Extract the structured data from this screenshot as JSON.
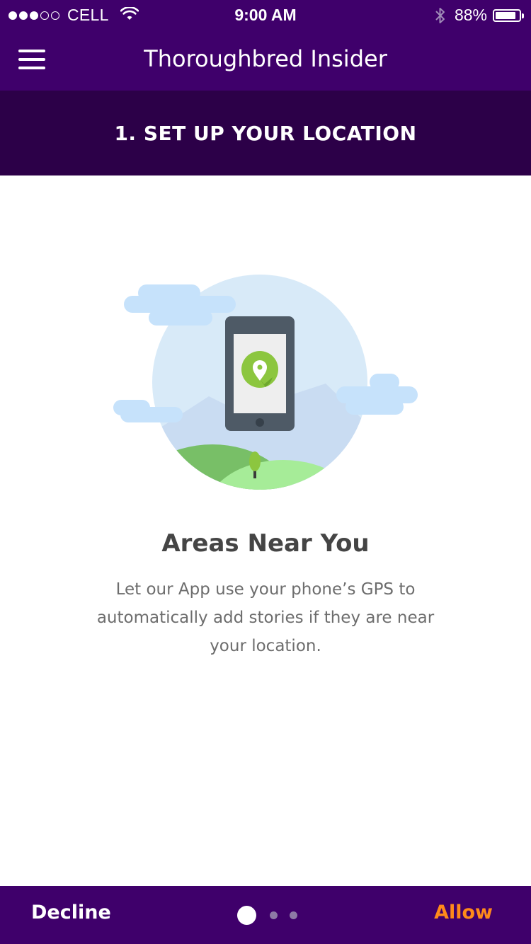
{
  "status_bar": {
    "carrier": "CELL",
    "time": "9:00 AM",
    "battery_percent_text": "88%",
    "battery_level": 0.88,
    "signal_full": 3,
    "signal_total": 5
  },
  "header": {
    "title": "Thoroughbred Insider"
  },
  "step": {
    "title": "1. SET UP YOUR LOCATION"
  },
  "content": {
    "heading": "Areas Near You",
    "description": "Let our App use your phone’s GPS to automatically add stories if they are near your location."
  },
  "footer": {
    "decline_label": "Decline",
    "allow_label": "Allow",
    "page_count": 3,
    "current_page": 1
  },
  "colors": {
    "brand_purple": "#3f006b",
    "dark_purple": "#2c0048",
    "accent_orange": "#ff8a1a",
    "pin_green": "#8cc63f"
  },
  "icons": {
    "menu": "hamburger-menu-icon",
    "wifi": "wifi-icon",
    "bluetooth": "bluetooth-icon",
    "battery": "battery-icon",
    "location": "location-pin-icon"
  }
}
